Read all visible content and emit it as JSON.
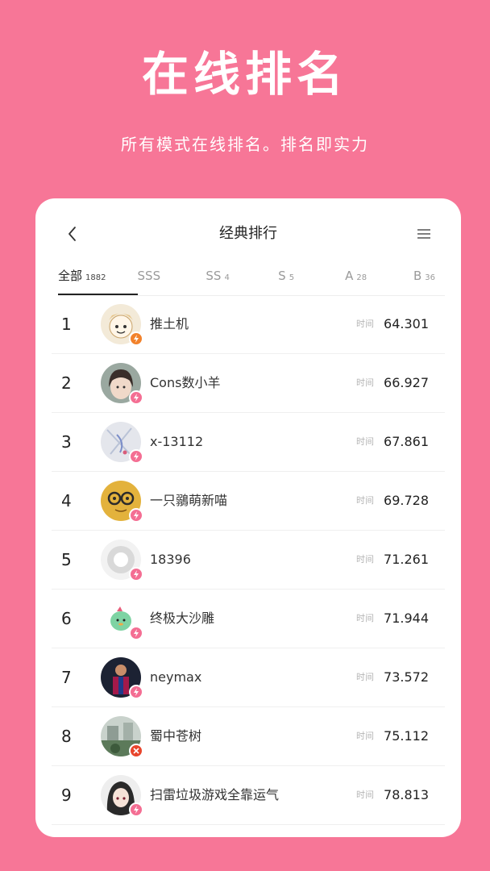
{
  "hero": {
    "title": "在线排名",
    "subtitle": "所有模式在线排名。排名即实力"
  },
  "header": {
    "title": "经典排行",
    "back_icon": "chevron-left-icon",
    "menu_icon": "hamburger-menu-icon"
  },
  "colors": {
    "background": "#F77697",
    "badge_pink": "#F46E93",
    "badge_red": "#E8452C",
    "badge_orange": "#F2822B"
  },
  "tabs": [
    {
      "label": "全部",
      "count": "1882",
      "active": true
    },
    {
      "label": "SSS",
      "count": "",
      "active": false
    },
    {
      "label": "SS",
      "count": "4",
      "active": false
    },
    {
      "label": "S",
      "count": "5",
      "active": false
    },
    {
      "label": "A",
      "count": "28",
      "active": false
    },
    {
      "label": "B",
      "count": "36",
      "active": false
    }
  ],
  "rows": [
    {
      "rank": "1",
      "name": "推土机",
      "time_label": "时间",
      "time": "64.301",
      "badge": "lightning-badge-orange"
    },
    {
      "rank": "2",
      "name": "Cons数小羊",
      "time_label": "时间",
      "time": "66.927",
      "badge": "lightning-badge-pink"
    },
    {
      "rank": "3",
      "name": "x-13112",
      "time_label": "时间",
      "time": "67.861",
      "badge": "lightning-badge-pink"
    },
    {
      "rank": "4",
      "name": "一只鶸萌新喵",
      "time_label": "时间",
      "time": "69.728",
      "badge": "lightning-badge-pink"
    },
    {
      "rank": "5",
      "name": "18396",
      "time_label": "时间",
      "time": "71.261",
      "badge": "lightning-badge-pink"
    },
    {
      "rank": "6",
      "name": "终极大沙雕",
      "time_label": "时间",
      "time": "71.944",
      "badge": "lightning-badge-pink"
    },
    {
      "rank": "7",
      "name": "neymax",
      "time_label": "时间",
      "time": "73.572",
      "badge": "lightning-badge-pink"
    },
    {
      "rank": "8",
      "name": "蜀中苍树",
      "time_label": "时间",
      "time": "75.112",
      "badge": "cross-badge-red"
    },
    {
      "rank": "9",
      "name": "扫雷垃圾游戏全靠运气",
      "time_label": "时间",
      "time": "78.813",
      "badge": "lightning-badge-pink"
    }
  ]
}
